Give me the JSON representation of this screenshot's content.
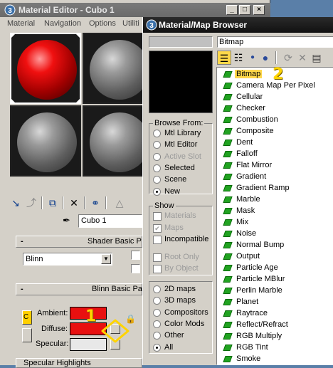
{
  "material_editor": {
    "title": "Material Editor - Cubo 1",
    "menu": [
      "Material",
      "Navigation",
      "Options",
      "Utiliti"
    ],
    "material_name": "Cubo 1",
    "shader_basic_title": "Shader Basic P",
    "shader_type": "Blinn",
    "blinn_basic_title": "Blinn Basic Par",
    "ambient_label": "Ambient:",
    "diffuse_label": "Diffuse:",
    "specular_label": "Specular:",
    "specular_highlights": "Specular Highlights",
    "ambient_color": "#e81010",
    "diffuse_color": "#e81010",
    "specular_color": "#e8e8e8",
    "callout_1": "1"
  },
  "browser": {
    "title": "Material/Map Browser",
    "current_type": "Bitmap",
    "browse_from_title": "Browse From:",
    "browse_from": [
      {
        "label": "Mtl Library",
        "checked": false,
        "disabled": false
      },
      {
        "label": "Mtl Editor",
        "checked": false,
        "disabled": false
      },
      {
        "label": "Active Slot",
        "checked": false,
        "disabled": true
      },
      {
        "label": "Selected",
        "checked": false,
        "disabled": false
      },
      {
        "label": "Scene",
        "checked": false,
        "disabled": false
      },
      {
        "label": "New",
        "checked": true,
        "disabled": false
      }
    ],
    "show_title": "Show",
    "show": [
      {
        "label": "Materials",
        "checked": false,
        "disabled": true
      },
      {
        "label": "Maps",
        "checked": true,
        "disabled": true
      },
      {
        "label": "Incompatible",
        "checked": false,
        "disabled": false
      },
      {
        "label": "Root Only",
        "checked": false,
        "disabled": true
      },
      {
        "label": "By Object",
        "checked": false,
        "disabled": true
      }
    ],
    "map_categories": [
      {
        "label": "2D maps",
        "checked": false
      },
      {
        "label": "3D maps",
        "checked": false
      },
      {
        "label": "Compositors",
        "checked": false
      },
      {
        "label": "Color Mods",
        "checked": false
      },
      {
        "label": "Other",
        "checked": false
      },
      {
        "label": "All",
        "checked": true
      }
    ],
    "maps": [
      "Bitmap",
      "Camera Map Per Pixel",
      "Cellular",
      "Checker",
      "Combustion",
      "Composite",
      "Dent",
      "Falloff",
      "Flat Mirror",
      "Gradient",
      "Gradient Ramp",
      "Marble",
      "Mask",
      "Mix",
      "Noise",
      "Normal Bump",
      "Output",
      "Particle Age",
      "Particle MBlur",
      "Perlin Marble",
      "Planet",
      "Raytrace",
      "Reflect/Refract",
      "RGB Multiply",
      "RGB Tint",
      "Smoke"
    ],
    "selected_map": "Bitmap",
    "callout_2": "2"
  }
}
